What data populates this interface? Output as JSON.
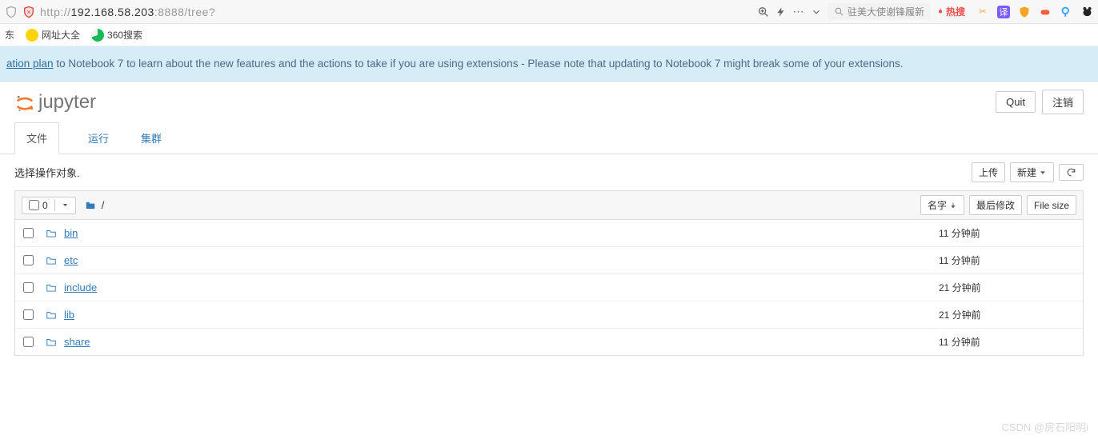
{
  "browser": {
    "url_prefix": "http://",
    "url_host": "192.168.58.203",
    "url_rest": ":8888/tree?",
    "search_placeholder": "驻美大使谢锋履新",
    "hot_label": "热搜"
  },
  "bookmarks": {
    "item1": "东",
    "item2": "网址大全",
    "item3": "360搜索"
  },
  "banner": {
    "link_text": "ation plan",
    "rest": " to Notebook 7 to learn about the new features and the actions to take if you are using extensions - Please note that updating to Notebook 7 might break some of your extensions."
  },
  "header": {
    "logo_text": "jupyter",
    "quit": "Quit",
    "logout": "注销"
  },
  "tabs": {
    "files": "文件",
    "running": "运行",
    "clusters": "集群"
  },
  "actions": {
    "select_prompt": "选择操作对象.",
    "upload": "上传",
    "new": "新建",
    "refresh": "⟳"
  },
  "list_header": {
    "count": "0",
    "path": "/",
    "name_col": "名字",
    "modified_col": "最后修改",
    "size_col": "File size"
  },
  "files": [
    {
      "name": "bin",
      "modified": "11 分钟前",
      "size": ""
    },
    {
      "name": "etc",
      "modified": "11 分钟前",
      "size": ""
    },
    {
      "name": "include",
      "modified": "21 分钟前",
      "size": ""
    },
    {
      "name": "lib",
      "modified": "21 分钟前",
      "size": ""
    },
    {
      "name": "share",
      "modified": "11 分钟前",
      "size": ""
    }
  ],
  "watermark": "CSDN @房石阳明i"
}
